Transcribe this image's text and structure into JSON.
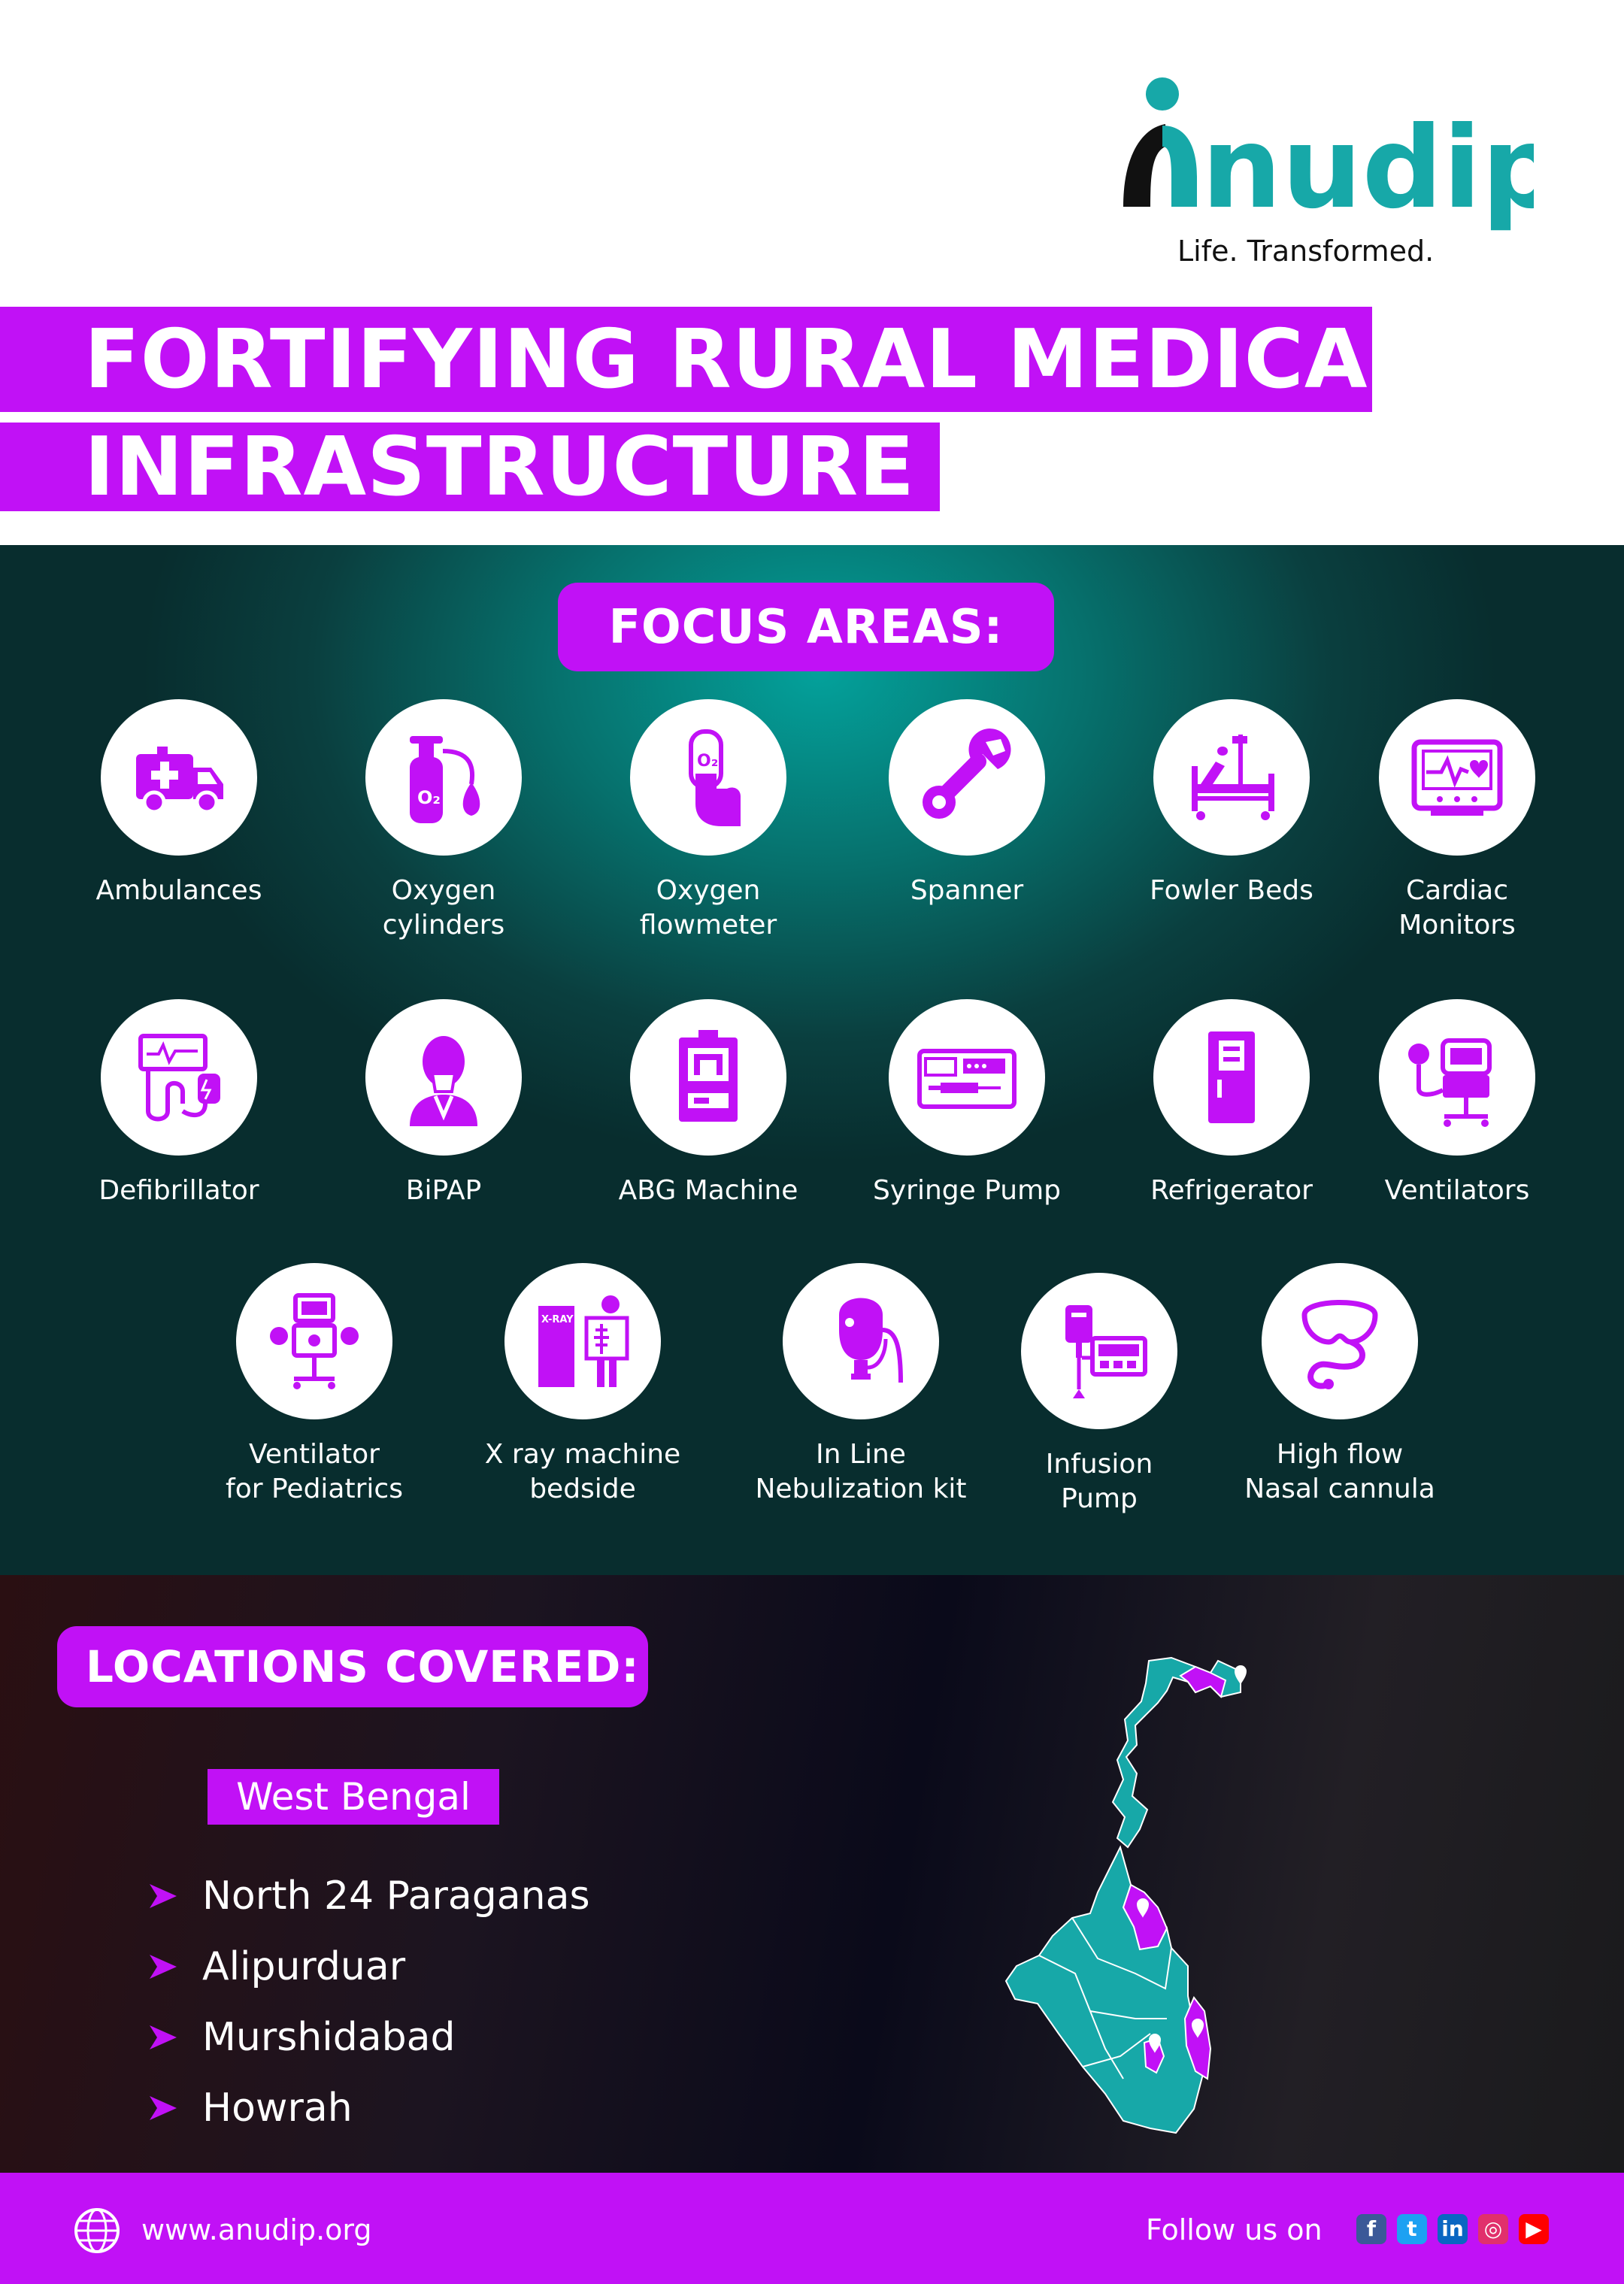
{
  "brand": {
    "name": "nudip",
    "tagline": "Life. Transformed.",
    "colors": {
      "purple": "#c111f6",
      "teal": "#17a8a8",
      "dark": "#111111"
    }
  },
  "title": {
    "line1": "FORTIFYING RURAL MEDICAL",
    "line2": "INFRASTRUCTURE"
  },
  "focus": {
    "heading": "FOCUS AREAS:",
    "items": [
      {
        "label": "Ambulances",
        "icon": "ambulance-icon"
      },
      {
        "label": "Oxygen\ncylinders",
        "icon": "oxygen-cylinder-icon"
      },
      {
        "label": "Oxygen\nflowmeter",
        "icon": "pulse-oximeter-icon"
      },
      {
        "label": "Spanner",
        "icon": "spanner-icon"
      },
      {
        "label": "Fowler Beds",
        "icon": "hospital-bed-icon"
      },
      {
        "label": "Cardiac\nMonitors",
        "icon": "heart-monitor-icon"
      },
      {
        "label": "Defibrillator",
        "icon": "defibrillator-icon"
      },
      {
        "label": "BiPAP",
        "icon": "bipap-mask-icon"
      },
      {
        "label": "ABG Machine",
        "icon": "abg-machine-icon"
      },
      {
        "label": "Syringe Pump",
        "icon": "syringe-pump-icon"
      },
      {
        "label": "Refrigerator",
        "icon": "refrigerator-icon"
      },
      {
        "label": "Ventilators",
        "icon": "ventilator-icon"
      },
      {
        "label": "Ventilator\nfor Pediatrics",
        "icon": "pediatric-ventilator-icon"
      },
      {
        "label": "X ray machine\nbedside",
        "icon": "xray-machine-icon",
        "icon_text": "X-RAY"
      },
      {
        "label": "In Line\nNebulization kit",
        "icon": "nebulizer-icon"
      },
      {
        "label": "Infusion\nPump",
        "icon": "infusion-pump-icon"
      },
      {
        "label": "High flow\nNasal cannula",
        "icon": "nasal-cannula-icon"
      }
    ]
  },
  "locations": {
    "heading": "LOCATIONS COVERED:",
    "state": "West Bengal",
    "districts": [
      "North 24 Paraganas",
      "Alipurduar",
      "Murshidabad",
      "Howrah"
    ]
  },
  "footer": {
    "website": "www.anudip.org",
    "follow_label": "Follow us on",
    "social": [
      {
        "name": "facebook-icon",
        "glyph": "f",
        "color": "#3b5998"
      },
      {
        "name": "twitter-icon",
        "glyph": "t",
        "color": "#1da1f2"
      },
      {
        "name": "linkedin-icon",
        "glyph": "in",
        "color": "#0a66c2"
      },
      {
        "name": "instagram-icon",
        "glyph": "◎",
        "color": "#e1306c"
      },
      {
        "name": "youtube-icon",
        "glyph": "▶",
        "color": "#ff0000"
      }
    ]
  }
}
